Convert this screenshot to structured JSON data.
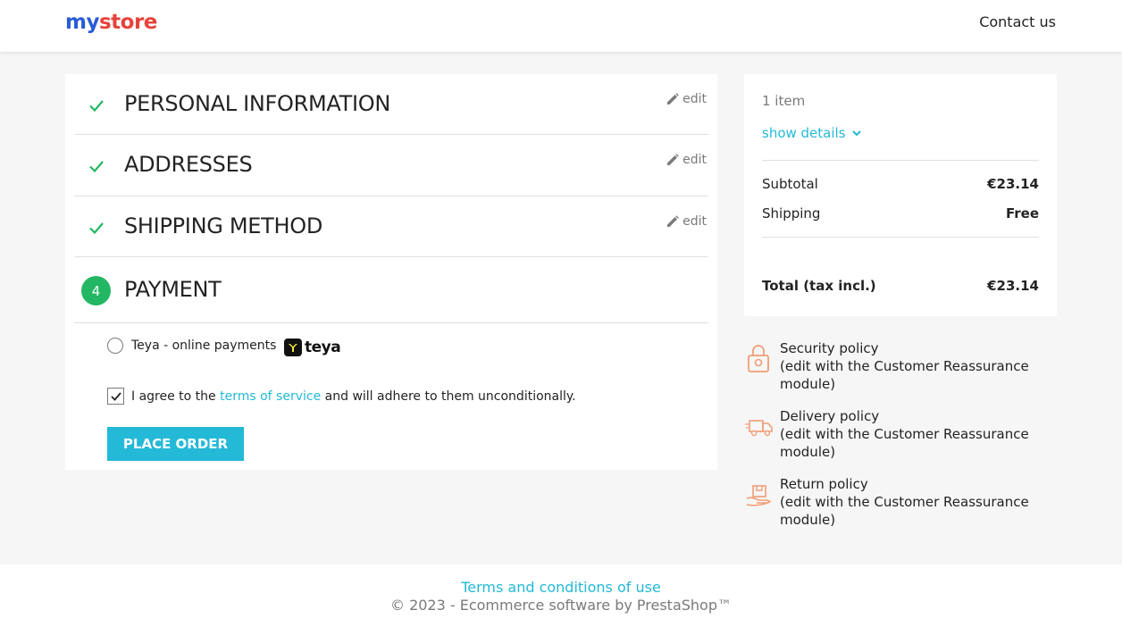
{
  "header": {
    "logo_parts": [
      "my",
      " ",
      "store"
    ],
    "contact_label": "Contact us"
  },
  "steps": [
    {
      "title": "PERSONAL INFORMATION",
      "edit_label": "edit",
      "state": "complete"
    },
    {
      "title": "ADDRESSES",
      "edit_label": "edit",
      "state": "complete"
    },
    {
      "title": "SHIPPING METHOD",
      "edit_label": "edit",
      "state": "complete"
    },
    {
      "number": "4",
      "title": "PAYMENT",
      "state": "current"
    }
  ],
  "payment": {
    "option_label": "Teya - online payments",
    "logo_text": "teya",
    "agree_prefix": "I agree to the ",
    "agree_link": "terms of service",
    "agree_suffix": " and will adhere to them unconditionally.",
    "agree_checked": true,
    "place_order_label": "PLACE ORDER"
  },
  "summary": {
    "items_count": "1 item",
    "show_details": "show details",
    "subtotal_label": "Subtotal",
    "subtotal_value": "€23.14",
    "shipping_label": "Shipping",
    "shipping_value": "Free",
    "total_label": "Total (tax incl.)",
    "total_value": "€23.14"
  },
  "reassurance": [
    {
      "title": "Security policy",
      "subtitle": "(edit with the Customer Reassurance module)",
      "icon": "lock-icon"
    },
    {
      "title": "Delivery policy",
      "subtitle": "(edit with the Customer Reassurance module)",
      "icon": "truck-icon"
    },
    {
      "title": "Return policy",
      "subtitle": "(edit with the Customer Reassurance module)",
      "icon": "return-box-icon"
    }
  ],
  "footer": {
    "terms_label": "Terms and conditions of use",
    "copyright": "© 2023 - Ecommerce software by PrestaShop™"
  },
  "colors": {
    "accent": "#24b9d7",
    "success": "#24b763",
    "reassurance_icon": "#f19d76"
  }
}
